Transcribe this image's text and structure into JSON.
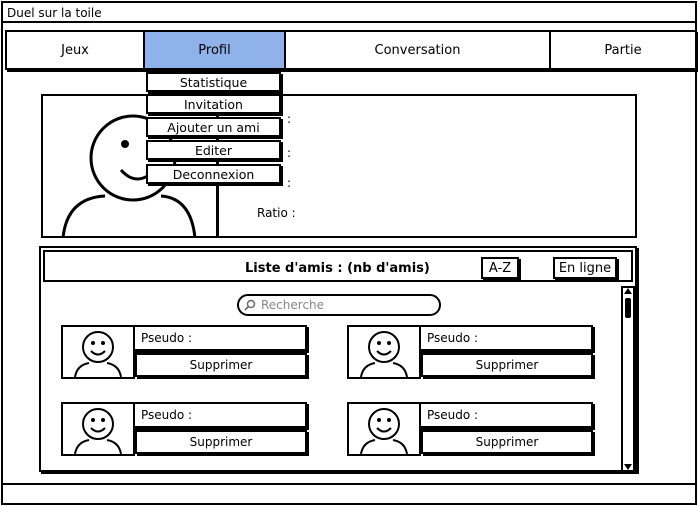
{
  "window": {
    "title": "Duel sur la toile"
  },
  "tabs": [
    {
      "label": "Jeux"
    },
    {
      "label": "Profil"
    },
    {
      "label": "Conversation"
    },
    {
      "label": "Partie"
    }
  ],
  "profile_menu": [
    {
      "label": "Statistique"
    },
    {
      "label": "Invitation"
    },
    {
      "label": "Ajouter un ami"
    },
    {
      "label": "Editer"
    },
    {
      "label": "Deconnexion"
    }
  ],
  "profile": {
    "field_colons": [
      ":",
      ":",
      ":"
    ],
    "ratio_label": "Ratio :"
  },
  "friends": {
    "title": "Liste d'amis : (nb d'amis)",
    "sort_az": "A-Z",
    "online": "En ligne",
    "search_placeholder": "Recherche",
    "cards": [
      {
        "pseudo": "Pseudo :",
        "delete": "Supprimer"
      },
      {
        "pseudo": "Pseudo :",
        "delete": "Supprimer"
      },
      {
        "pseudo": "Pseudo :",
        "delete": "Supprimer"
      },
      {
        "pseudo": "Pseudo :",
        "delete": "Supprimer"
      }
    ]
  },
  "colors": {
    "active_tab": "#8fb2ea"
  }
}
